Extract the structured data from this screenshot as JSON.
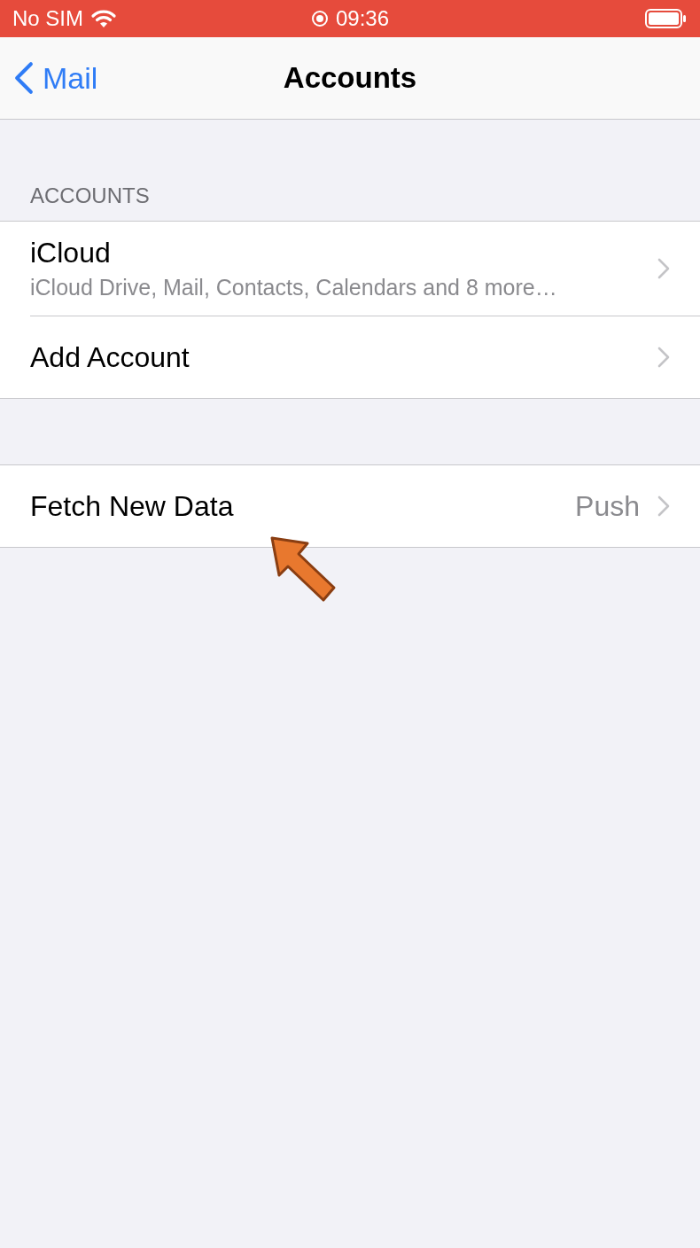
{
  "status_bar": {
    "carrier": "No SIM",
    "time": "09:36"
  },
  "nav_bar": {
    "back": "Mail",
    "title": "Accounts"
  },
  "sections": [
    {
      "header": "ACCOUNTS",
      "rows": [
        {
          "title": "iCloud",
          "subtitle": "iCloud Drive, Mail, Contacts, Calendars and 8 more…"
        },
        {
          "title": "Add Account"
        }
      ]
    },
    {
      "rows": [
        {
          "title": "Fetch New Data",
          "value": "Push"
        }
      ]
    }
  ],
  "annotation": {
    "kind": "arrow"
  }
}
